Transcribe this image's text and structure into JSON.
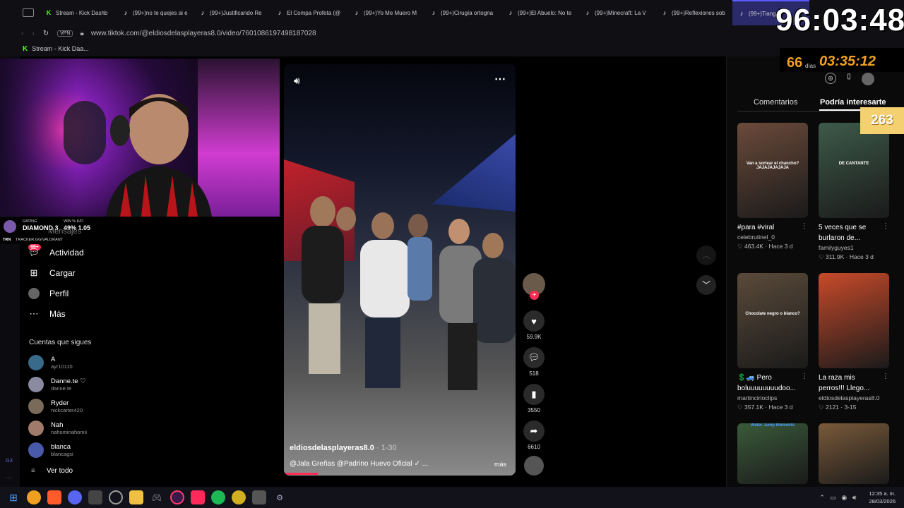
{
  "browser": {
    "tabs": [
      {
        "label": "Stream - Kick Dashb",
        "icon": "kick-icon",
        "color": "#53fc18"
      },
      {
        "label": "(99+)no te quejes ai e",
        "icon": "tiktok-icon",
        "color": "#fff"
      },
      {
        "label": "(99+)Justificando Re",
        "icon": "tiktok-icon",
        "color": "#fff"
      },
      {
        "label": "El Compa Profeta (@",
        "icon": "tiktok-icon",
        "color": "#fff"
      },
      {
        "label": "(99+)Yo Me Muero M",
        "icon": "tiktok-icon",
        "color": "#fff"
      },
      {
        "label": "(99+)Cirugía ortogna",
        "icon": "tiktok-icon",
        "color": "#fff"
      },
      {
        "label": "(99+)El Abuelo: No te",
        "icon": "tiktok-icon",
        "color": "#fff"
      },
      {
        "label": "(99+)Minecraft: La V",
        "icon": "tiktok-icon",
        "color": "#fff"
      },
      {
        "label": "(99+)Reflexiones sob",
        "icon": "tiktok-icon",
        "color": "#fff"
      },
      {
        "label": "(99+)Tiangui",
        "icon": "tiktok-icon",
        "color": "#fff",
        "active": true
      }
    ],
    "vpn_label": "VPN",
    "url": "www.tiktok.com/@eldiosdelasplayeras8.0/video/7601086197498187028",
    "bookmark": "Stream - Kick Daa..."
  },
  "overlay": {
    "timer": "96:03:48",
    "days_count": "66",
    "days_label": "días",
    "days_time": "03:35:12",
    "viewer_badge": "263",
    "rating_label": "RATING",
    "rating_value": "DIAMOND 3",
    "winkd_label": "WIN % K/D",
    "winkd_value": "49% 1.05",
    "tracker": "TRACKER.GG/VALORANT",
    "tracker_prefix": "TRN"
  },
  "sidebar": {
    "messages_label": "Mensajes",
    "messages_badge": "99+",
    "items": [
      {
        "label": "Actividad",
        "icon": "activity-icon"
      },
      {
        "label": "Cargar",
        "icon": "upload-icon"
      },
      {
        "label": "Perfil",
        "icon": "profile-icon"
      },
      {
        "label": "Más",
        "icon": "more-icon"
      }
    ],
    "following_title": "Cuentas que sigues",
    "following": [
      {
        "name": "A",
        "handle": "ayr10110",
        "color": "#3a6a8a"
      },
      {
        "name": "Danne.te ♡",
        "handle": "danne.te",
        "color": "#8a8aa0"
      },
      {
        "name": "Ryder",
        "handle": "nickcarter420",
        "color": "#7a6a5a"
      },
      {
        "name": "Nah",
        "handle": "nahominahomii",
        "color": "#a07a6a"
      },
      {
        "name": "blanca",
        "handle": "blancagsi",
        "color": "#4a5aaa"
      }
    ],
    "see_all": "Ver todo"
  },
  "video": {
    "author": "eldiosdelasplayeras8.0",
    "duration": "1-30",
    "caption": "@Jala Greñas @Padrino Huevo Oficial ✓ ...",
    "more": "más"
  },
  "actions": {
    "likes": "59.9K",
    "comments": "518",
    "saves": "3550",
    "shares": "6610"
  },
  "right_panel": {
    "tab_comments": "Comentarios",
    "tab_suggested": "Podría interesarte",
    "cards": [
      {
        "title": "#para #viral",
        "author": "celebrutinel_0",
        "views": "463.4K",
        "time": "Hace 3 d",
        "thumb": "#6b4a3a",
        "overlay": "Van a sortear el chancho? JAJAJAJAJAJA"
      },
      {
        "title": "5 veces que se burlaron de...",
        "author": "familyguyes1",
        "views": "311.9K",
        "time": "Hace 3 d",
        "thumb": "#3d5a4a",
        "overlay": "DE CANTANTE"
      },
      {
        "title": "💲🚙 Pero boluuuuuuuudoo...",
        "author": "martincirioclips",
        "views": "357.1K",
        "time": "Hace 3 d",
        "thumb": "#5a4a3a",
        "overlay": "Chocolate negro o blanco?"
      },
      {
        "title": "La raza mis perros!!! Llego...",
        "author": "eldiosdelasplayeras8.0",
        "views": "2121",
        "time": "3-15",
        "thumb": "#c84a2a",
        "overlay": ""
      },
      {
        "title": "",
        "author": "",
        "views": "",
        "time": "",
        "thumb": "#3a5a3a",
        "overlay": "Water Jump Moments"
      },
      {
        "title": "",
        "author": "",
        "views": "",
        "time": "",
        "thumb": "#7a5a3a",
        "overlay": ""
      }
    ]
  },
  "taskbar": {
    "time": "12:35 a. m.",
    "date": "28/03/2026"
  }
}
